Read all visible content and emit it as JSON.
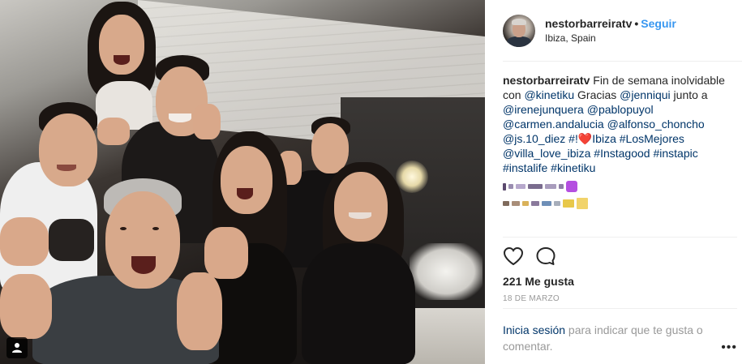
{
  "post": {
    "username": "nestorbarreiratv",
    "separator": "•",
    "follow_label": "Seguir",
    "location": "Ibiza, Spain"
  },
  "caption": {
    "username": "nestorbarreiratv",
    "t1": " Fin de semana inolvidable con ",
    "m1": "@kinetiku",
    "t2": " Gracias ",
    "m2": "@jenniqui",
    "t3": " junto a ",
    "m3": "@irenejunquera",
    "t4": " ",
    "m4": "@pablopuyol",
    "t5": " ",
    "m5": "@carmen.andalucia",
    "t6": " ",
    "m6": "@alfonso_choncho",
    "t7": " ",
    "m7": "@js.10_diez",
    "t8": " ",
    "m8": "#!",
    "heart": "❤️",
    "m9": "Ibiza",
    "t9": " ",
    "m10": "#LosMejores",
    "t10": " ",
    "m11": "@villa_love_ibiza",
    "t11": " ",
    "m12": "#Instagood",
    "t12": " ",
    "m13": "#instapic",
    "t13": " ",
    "m14": "#instalife",
    "t14": " ",
    "m15": "#kinetiku"
  },
  "stats": {
    "likes": "221 Me gusta",
    "date": "18 DE MARZO"
  },
  "login": {
    "link": "Inicia sesión",
    "text": " para indicar que te gusta o comentar.",
    "more_icon": "•••"
  },
  "icons": {
    "like": "heart-outline-icon",
    "comment": "comment-bubble-icon",
    "tagged": "person-tag-icon"
  },
  "colors": {
    "link_blue": "#3897f0",
    "mention": "#003569",
    "text": "#262626",
    "muted": "#999999"
  }
}
